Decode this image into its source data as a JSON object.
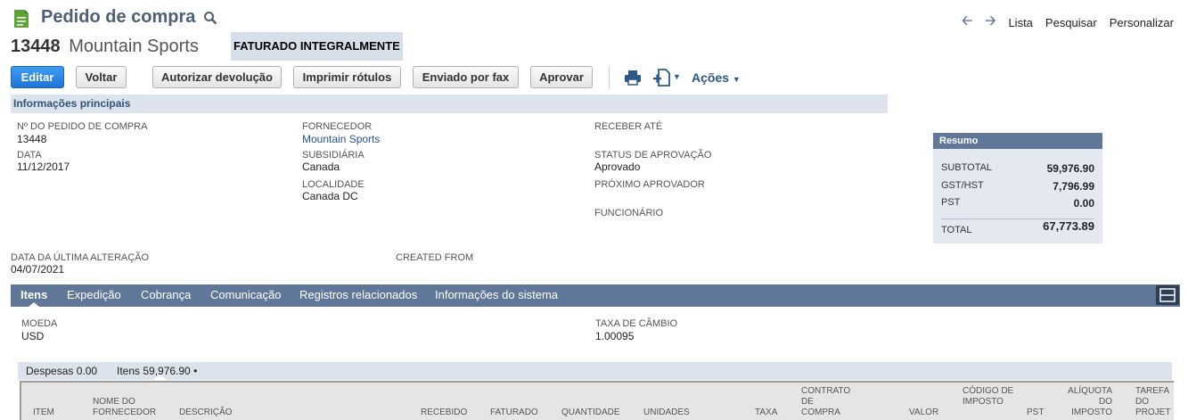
{
  "header": {
    "title": "Pedido de compra",
    "nav": {
      "list": "Lista",
      "search": "Pesquisar",
      "customize": "Personalizar"
    }
  },
  "record": {
    "number": "13448",
    "name": "Mountain Sports",
    "status": "FATURADO INTEGRALMENTE"
  },
  "toolbar": {
    "edit": "Editar",
    "back": "Voltar",
    "authorize_return": "Autorizar devolução",
    "print_labels": "Imprimir rótulos",
    "fax": "Enviado por fax",
    "approve": "Aprovar",
    "actions": "Ações"
  },
  "main_info": {
    "section_title": "Informações principais",
    "po_number_label": "Nº DO PEDIDO DE COMPRA",
    "po_number": "13448",
    "date_label": "DATA",
    "date": "11/12/2017",
    "vendor_label": "FORNECEDOR",
    "vendor": "Mountain Sports",
    "subsidiary_label": "SUBSIDIÁRIA",
    "subsidiary": "Canada",
    "location_label": "LOCALIDADE",
    "location": "Canada DC",
    "receive_by_label": "RECEBER ATÉ",
    "approval_status_label": "STATUS DE APROVAÇÃO",
    "approval_status": "Aprovado",
    "next_approver_label": "PRÓXIMO APROVADOR",
    "employee_label": "FUNCIONÁRIO",
    "last_modified_label": "DATA DA ÚLTIMA ALTERAÇÃO",
    "last_modified": "04/07/2021",
    "created_from_label": "CREATED FROM"
  },
  "summary": {
    "title": "Resumo",
    "subtotal_label": "SUBTOTAL",
    "subtotal": "59,976.90",
    "gst_label": "GST/HST",
    "gst": "7,796.99",
    "pst_label": "PST",
    "pst": "0.00",
    "total_label": "TOTAL",
    "total": "67,773.89"
  },
  "tabs": [
    {
      "label": "Itens"
    },
    {
      "label": "Expedição"
    },
    {
      "label": "Cobrança"
    },
    {
      "label": "Comunicação"
    },
    {
      "label": "Registros relacionados"
    },
    {
      "label": "Informações do sistema"
    }
  ],
  "items_tab": {
    "currency_label": "MOEDA",
    "currency": "USD",
    "exchange_rate_label": "TAXA DE CÂMBIO",
    "exchange_rate": "1.00095",
    "expenses_label": "Despesas 0.00",
    "items_label": "Itens 59,976.90 •",
    "columns": [
      "ITEM",
      "NOME DO FORNECEDOR",
      "DESCRIÇÃO",
      "RECEBIDO",
      "FATURADO",
      "QUANTIDADE",
      "UNIDADES",
      "TAXA",
      "CONTRATO DE COMPRA",
      "VALOR",
      "CÓDIGO DE IMPOSTO",
      "PST",
      "ALÍQUOTA DO IMPOSTO",
      "TAREFA DO PROJET"
    ]
  },
  "colors": {
    "primary_button": "#1f74d6",
    "tab_bar": "#607799",
    "section_bg": "#dce3ec",
    "link": "#255599"
  }
}
